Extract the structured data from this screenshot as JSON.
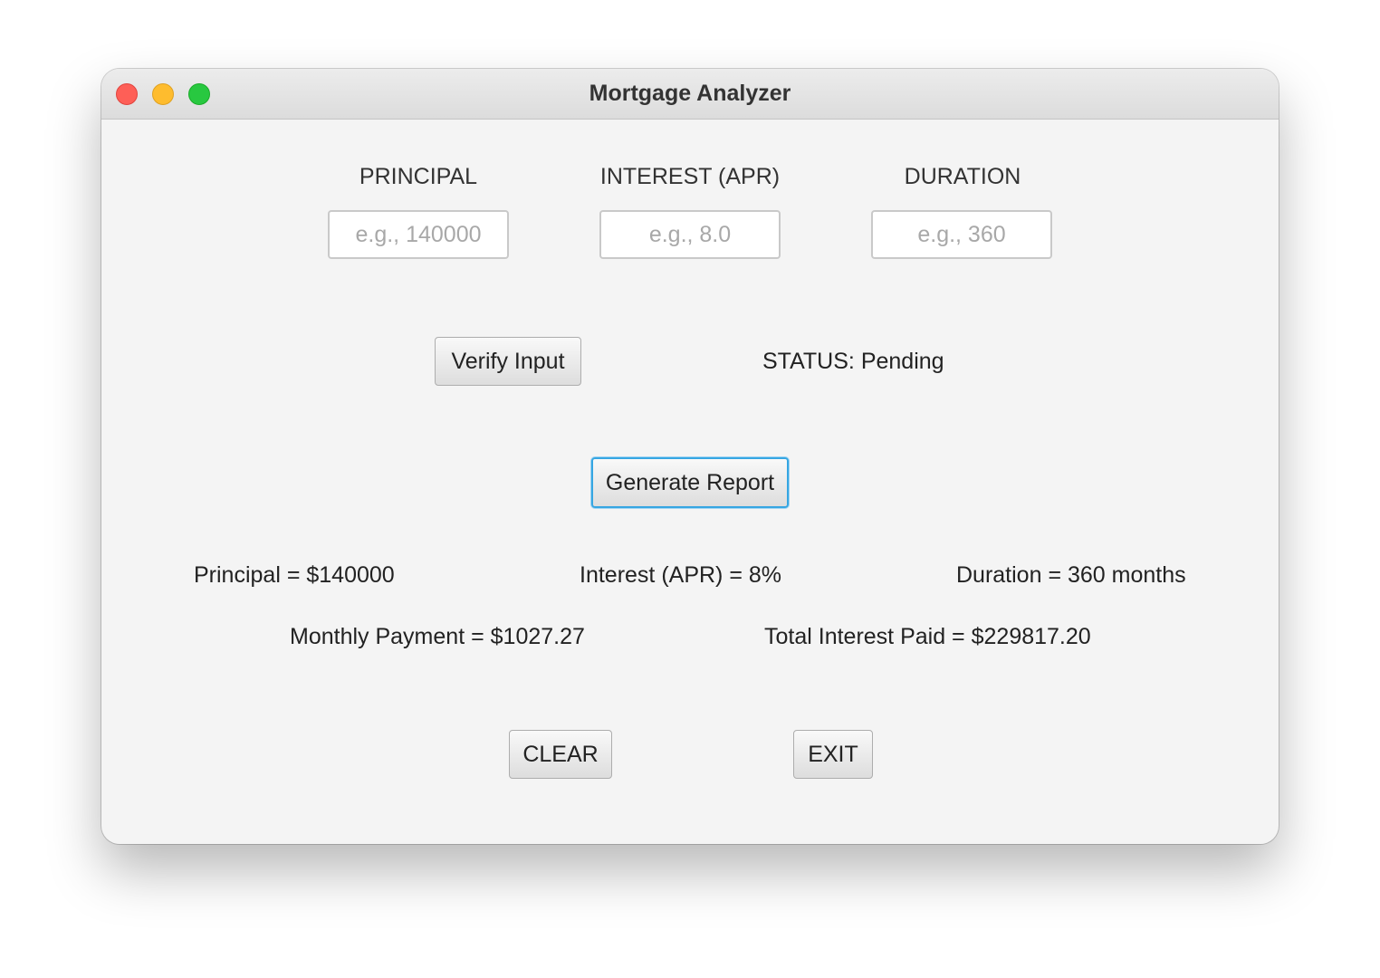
{
  "window": {
    "title": "Mortgage Analyzer"
  },
  "inputs": {
    "principal": {
      "label": "PRINCIPAL",
      "value": "",
      "placeholder": "e.g., 140000"
    },
    "interest": {
      "label": "INTEREST (APR)",
      "value": "",
      "placeholder": "e.g., 8.0"
    },
    "duration": {
      "label": "DURATION",
      "value": "",
      "placeholder": "e.g., 360"
    }
  },
  "actions": {
    "verify_label": "Verify Input",
    "generate_label": "Generate Report",
    "clear_label": "CLEAR",
    "exit_label": "EXIT"
  },
  "status": {
    "label": "STATUS:",
    "value": "Pending"
  },
  "report": {
    "principal": "Principal = $140000",
    "interest": "Interest (APR) = 8%",
    "duration": "Duration = 360 months",
    "monthly_payment": "Monthly Payment = $1027.27",
    "total_interest": "Total Interest Paid = $229817.20"
  },
  "colors": {
    "window_bg": "#f4f4f4",
    "close": "#fe5f57",
    "minimize": "#febc2e",
    "maximize": "#28c840",
    "focus_ring": "#36a6e2"
  }
}
